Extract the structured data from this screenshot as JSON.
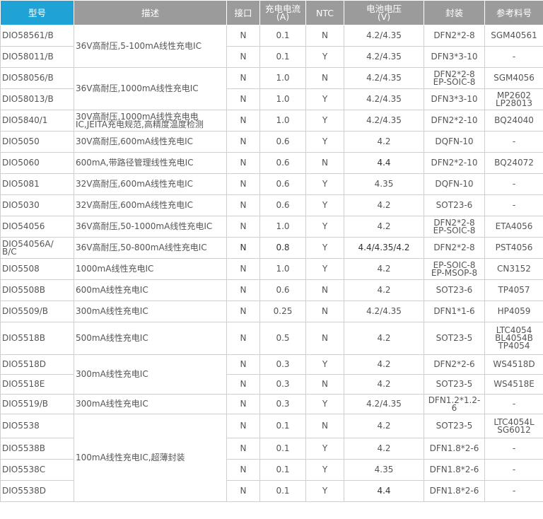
{
  "headers": [
    "型号",
    "描述",
    "接口",
    "充电电流\n(A)",
    "NTC",
    "电池电压\n(V)",
    "封装",
    "参考料号"
  ],
  "descriptions": {
    "d1": "36V高耐压,5-100mA线性充电IC",
    "d2": "36V高耐压,1000mA线性充电IC",
    "d3": "30V高耐压,1000mA线性充电电\nIC,JEITA充电规范,高精度温度检测",
    "d4": "30V高耐压,600mA线性充电IC",
    "d5": "600mA,带路径管理线性充电IC",
    "d6": "32V高耐压,600mA线性充电IC",
    "d7": "32V高耐压,600mA线性充电IC",
    "d8": "36V高耐压,50-1000mA线性充电IC",
    "d9": "36V高耐压,50-800mA线性充电IC",
    "d10": "1000mA线性充电IC",
    "d11": "600mA线性充电IC",
    "d12": "300mA线性充电IC",
    "d13": "500mA线性充电IC",
    "d14": "300mA线性充电IC",
    "d15": "300mA线性充电IC",
    "d16": "100mA线性充电IC,超薄封装"
  },
  "rows": [
    {
      "model": "DIO58561/B",
      "iface": "N",
      "current": "0.1",
      "ntc": "N",
      "voltage": "4.2/4.35",
      "pkg": "DFN2*2-8",
      "ref": "SGM40561"
    },
    {
      "model": "DIO58011/B",
      "iface": "N",
      "current": "0.1",
      "ntc": "Y",
      "voltage": "4.2/4.35",
      "pkg": "DFN3*3-10",
      "ref": "-"
    },
    {
      "model": "DIO58056/B",
      "iface": "N",
      "current": "1.0",
      "ntc": "N",
      "voltage": "4.2/4.35",
      "pkg": "DFN2*2-8\nEP-SOIC-8",
      "ref": "SGM4056"
    },
    {
      "model": "DIO58013/B",
      "iface": "N",
      "current": "1.0",
      "ntc": "Y",
      "voltage": "4.2/4.35",
      "pkg": "DFN3*3-10",
      "ref": "MP2602\nLP28013"
    },
    {
      "model": "DIO5840/1",
      "iface": "N",
      "current": "1.0",
      "ntc": "Y",
      "voltage": "4.2/4.35",
      "pkg": "DFN2*2-10",
      "ref": "BQ24040"
    },
    {
      "model": "DIO5050",
      "iface": "N",
      "current": "0.6",
      "ntc": "Y",
      "voltage": "4.2",
      "pkg": "DQFN-10",
      "ref": "-"
    },
    {
      "model": "DIO5060",
      "iface": "N",
      "current": "0.6",
      "ntc": "N",
      "voltage": "4.4",
      "pkg": "DFN2*2-10",
      "ref": "BQ24072"
    },
    {
      "model": "DIO5081",
      "iface": "N",
      "current": "0.6",
      "ntc": "Y",
      "voltage": "4.35",
      "pkg": "DQFN-10",
      "ref": "-"
    },
    {
      "model": "DIO5030",
      "iface": "N",
      "current": "0.6",
      "ntc": "Y",
      "voltage": "4.2",
      "pkg": "SOT23-6",
      "ref": "-"
    },
    {
      "model": "DIO54056",
      "iface": "N",
      "current": "1.0",
      "ntc": "Y",
      "voltage": "4.2",
      "pkg": "DFN2*2-8\nEP-SOIC-8",
      "ref": "ETA4056"
    },
    {
      "model": "DIO54056A/\nB/C",
      "iface": "N",
      "current": "0.8",
      "ntc": "Y",
      "voltage": "4.4/4.35/4.2",
      "pkg": "DFN2*2-8",
      "ref": "PST4056"
    },
    {
      "model": "DIO5508",
      "iface": "N",
      "current": "1.0",
      "ntc": "Y",
      "voltage": "4.2",
      "pkg": "EP-SOIC-8\nEP-MSOP-8",
      "ref": "CN3152"
    },
    {
      "model": "DIO5508B",
      "iface": "N",
      "current": "0.6",
      "ntc": "N",
      "voltage": "4.2",
      "pkg": "SOT23-6",
      "ref": "TP4057"
    },
    {
      "model": "DIO5509/B",
      "iface": "N",
      "current": "0.25",
      "ntc": "N",
      "voltage": "4.2/4.35",
      "pkg": "DFN1*1-6",
      "ref": "HP4059"
    },
    {
      "model": "DIO5518B",
      "iface": "N",
      "current": "0.5",
      "ntc": "N",
      "voltage": "4.2",
      "pkg": "SOT23-5",
      "ref": "LTC4054\nBL4054B\nTP4054"
    },
    {
      "model": "DIO5518D",
      "iface": "N",
      "current": "0.3",
      "ntc": "Y",
      "voltage": "4.2",
      "pkg": "DFN2*2-6",
      "ref": "WS4518D"
    },
    {
      "model": "DIO5518E",
      "iface": "N",
      "current": "0.3",
      "ntc": "N",
      "voltage": "4.2",
      "pkg": "SOT23-5",
      "ref": "WS4518E"
    },
    {
      "model": "DIO5519/B",
      "iface": "N",
      "current": "0.3",
      "ntc": "Y",
      "voltage": "4.2/4.35",
      "pkg": "DFN1.2*1.2-6",
      "ref": "-"
    },
    {
      "model": "DIO5538",
      "iface": "N",
      "current": "0.1",
      "ntc": "N",
      "voltage": "4.2",
      "pkg": "SOT23-5",
      "ref": "LTC4054L\nSG6012"
    },
    {
      "model": "DIO5538B",
      "iface": "N",
      "current": "0.1",
      "ntc": "Y",
      "voltage": "4.2",
      "pkg": "DFN1.8*2-6",
      "ref": "-"
    },
    {
      "model": "DIO5538C",
      "iface": "N",
      "current": "0.1",
      "ntc": "Y",
      "voltage": "4.35",
      "pkg": "DFN1.8*2-6",
      "ref": "-"
    },
    {
      "model": "DIO5538D",
      "iface": "N",
      "current": "0.1",
      "ntc": "Y",
      "voltage": "4.4",
      "pkg": "DFN1.8*2-6",
      "ref": "-"
    }
  ]
}
